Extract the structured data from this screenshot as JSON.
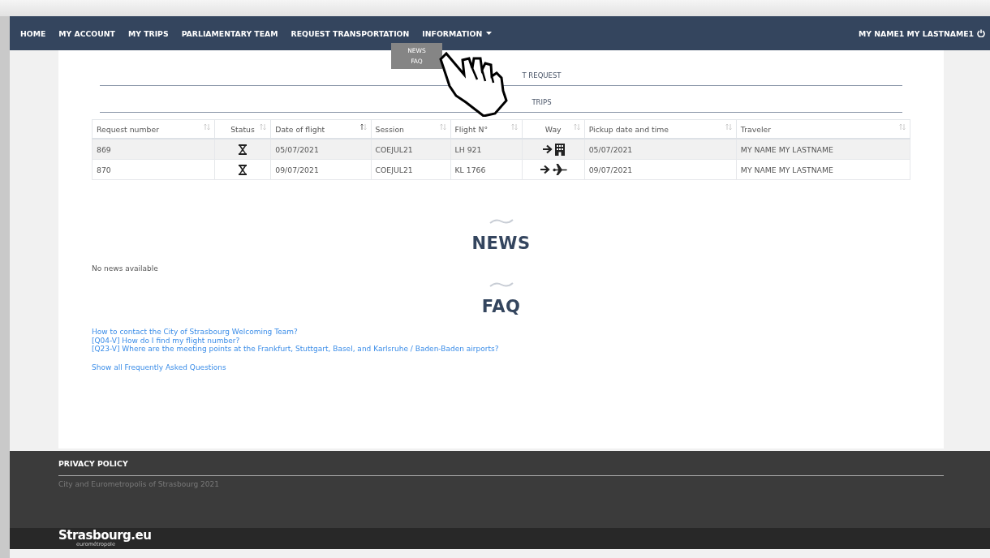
{
  "nav": {
    "items": [
      {
        "label": "HOME",
        "dropdown": false
      },
      {
        "label": "MY ACCOUNT",
        "dropdown": false
      },
      {
        "label": "MY TRIPS",
        "dropdown": false
      },
      {
        "label": "PARLIAMENTARY TEAM",
        "dropdown": false
      },
      {
        "label": "REQUEST TRANSPORTATION",
        "dropdown": false
      },
      {
        "label": "INFORMATION",
        "dropdown": true
      }
    ],
    "user": "MY NAME1 MY LASTNAME1",
    "menu": [
      "NEWS",
      "FAQ"
    ]
  },
  "sections": [
    "T REQUEST",
    "TRIPS"
  ],
  "table": {
    "columns": [
      {
        "label": "Request number",
        "sorted": false
      },
      {
        "label": "Status",
        "sorted": false
      },
      {
        "label": "Date of flight",
        "sorted": true
      },
      {
        "label": "Session",
        "sorted": false
      },
      {
        "label": "Flight N°",
        "sorted": false
      },
      {
        "label": "Way",
        "sorted": false
      },
      {
        "label": "Pickup date and time",
        "sorted": false
      },
      {
        "label": "Traveler",
        "sorted": false
      }
    ],
    "rows": [
      {
        "kind": "building",
        "request": "869",
        "date": "05/07/2021",
        "session": "COEJUL21",
        "flight": "LH 921",
        "pickup": "05/07/2021",
        "traveler": "MY NAME MY LASTNAME"
      },
      {
        "kind": "plane",
        "request": "870",
        "date": "09/07/2021",
        "session": "COEJUL21",
        "flight": "KL 1766",
        "pickup": "09/07/2021",
        "traveler": "MY NAME MY LASTNAME"
      }
    ]
  },
  "news": {
    "title": "NEWS",
    "empty": "No news available"
  },
  "faq": {
    "title": "FAQ",
    "links": [
      "How to contact the City of Strasbourg Welcoming Team?",
      "[Q04-V] How do I find my flight number?",
      "[Q23-V] Where are the meeting points at the Frankfurt, Stuttgart, Basel, and Karlsruhe / Baden-Baden airports?"
    ],
    "all": "Show all Frequently Asked Questions"
  },
  "footer": {
    "link": "PRIVACY POLICY",
    "copyright": "City and Eurometropolis of Strasbourg 2021",
    "logo": "Strasbourg.eu",
    "logo_sub": "eurométropole"
  }
}
